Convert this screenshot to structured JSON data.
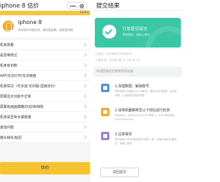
{
  "left": {
    "nav_title": "iphone 8 估价",
    "progress": {
      "text": "12/12",
      "fraction": 1.0
    },
    "device": {
      "name": "iphone 8",
      "tip": "如实填写详细信息，想估更准确，收款更快捷"
    },
    "questions": [
      "机身靠着",
      "是否维修过",
      "机身有划痕",
      "WIFI无法打开/无法链接",
      "机身情况（可多选-无问题-直接定价）",
      "屏幕显示功能不正常",
      "屏幕有画面摸糊/抖动/有缺陷",
      "机身是否有水或受潮",
      "其他问题",
      "镜头缺失/延迟"
    ],
    "estimate_label": "估价"
  },
  "right": {
    "nav_title": "提交结果",
    "success": {
      "title": "订单提交成功",
      "subtitle": "等待预约，请耐心等待"
    },
    "order": {
      "line1": "订单号：20180817185015",
      "line2": "下单时间：2018-08-17 18:50:15"
    },
    "tip": "快递回收前您需要完成准备",
    "steps": [
      {
        "title": "1.清理数据、解锁账号",
        "desc": "请在邮寄之前退出iCloud帐号、清除手机内数据、手机密码等，以免回收后信息泄露",
        "color": "#4a90e2"
      },
      {
        "title": "2.请将机器邮寄至以下地址进行检测",
        "desc": "回收地址：北京市XXXXXXXX 联系人：XXX 联系电话：XXXXXXXXXXX",
        "color": "#f5a623"
      },
      {
        "title": "3.注意事项",
        "desc": "请仔细核对手机机型是否与预约一致，检测后我们会通知您，请耐心等待",
        "color": "#9b7fd4"
      }
    ],
    "home_label": "返回首页"
  },
  "colors": {
    "accent_yellow": "#f7c42f",
    "success_green": "#3cc7a4"
  }
}
